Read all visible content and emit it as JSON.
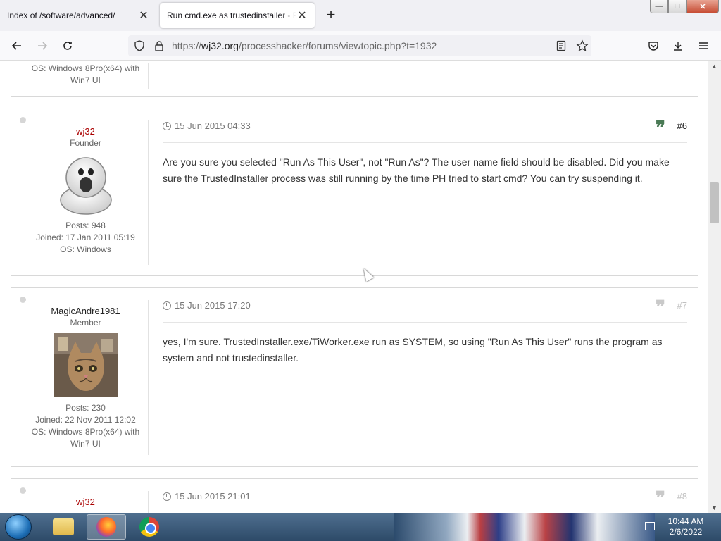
{
  "tabs": [
    {
      "title": "Index of /software/advanced/",
      "active": false
    },
    {
      "title": "Run cmd.exe as trustedinstaller - Process Hacker",
      "active": true
    }
  ],
  "window_controls": {
    "minimize": "—",
    "maximize": "□",
    "close": "✕"
  },
  "url": {
    "scheme": "https://",
    "host": "wj32.org",
    "path": "/processhacker/forums/viewtopic.php?t=1932"
  },
  "colors": {
    "founder_name": "#aa0000",
    "quote_active": "#105289",
    "link": "#105289"
  },
  "previous_post": {
    "os_line1": "OS: Windows 8Pro(x64) with",
    "os_line2": "Win7 UI"
  },
  "posts": [
    {
      "username": "wj32",
      "rank": "Founder",
      "avatar_icon": "ghost-avatar-icon",
      "posts": "Posts: 948",
      "joined": "Joined: 17 Jan 2011 05:19",
      "os": "OS: Windows",
      "time": "15 Jun 2015 04:33",
      "number": "#6",
      "text_line1": "Are you sure you selected \"Run As This User\", not \"Run As\"? The user name field should be disabled. Did you make",
      "text_line2": "sure the TrustedInstaller process was still running by the time PH tried to start cmd? You can try suspending it."
    },
    {
      "username": "MagicAndre1981",
      "rank": "Member",
      "avatar_icon": "cat-avatar-icon",
      "posts": "Posts: 230",
      "joined": "Joined: 22 Nov 2011 12:02",
      "os_line1": "OS: Windows 8Pro(x64) with",
      "os_line2": "Win7 UI",
      "time": "15 Jun 2015 17:20",
      "number": "#7",
      "text_line1": "yes, I'm sure. TrustedInstaller.exe/TiWorker.exe run as SYSTEM, so using \"Run As This User\" runs the program as",
      "text_line2": "system and not trustedinstaller."
    },
    {
      "username": "wj32",
      "time": "15 Jun 2015 21:01",
      "number": "#8"
    }
  ],
  "taskbar": {
    "time": "10:44 AM",
    "date": "2/6/2022"
  }
}
